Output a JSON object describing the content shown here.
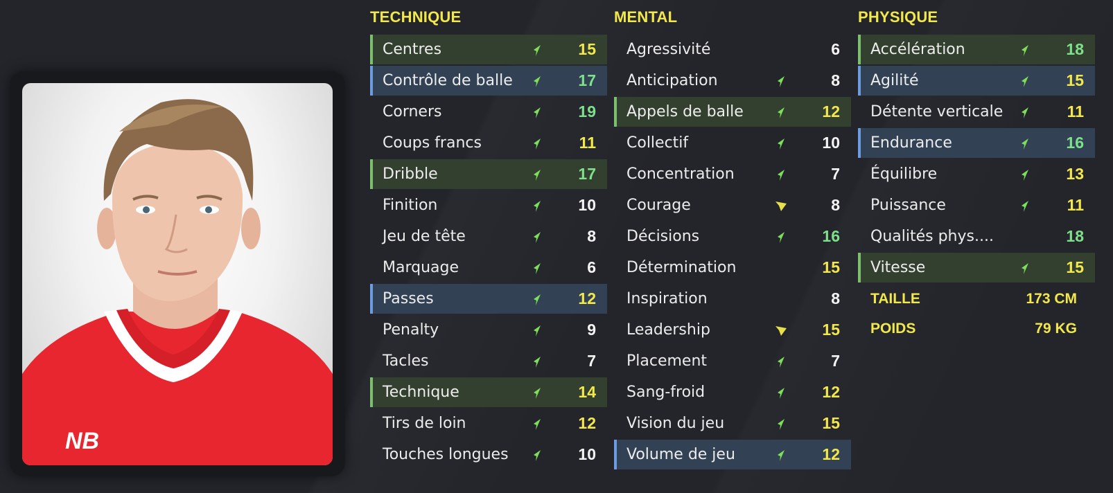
{
  "colors": {
    "header": "#f2e84c",
    "value_white": "#f4f4f4",
    "value_yellow": "#f2e84c",
    "value_green": "#7ee08a",
    "highlight_green": "#34402f",
    "highlight_blue": "#324254",
    "arrow_up": "#7ee05a",
    "arrow_neutral": "#e8e04a"
  },
  "technique": {
    "header": "TECHNIQUE",
    "rows": [
      {
        "label": "Centres",
        "value": "15",
        "tone": "yellow",
        "arrow": "up",
        "hl": "green"
      },
      {
        "label": "Contrôle de balle",
        "value": "17",
        "tone": "green",
        "arrow": "up",
        "hl": "blue"
      },
      {
        "label": "Corners",
        "value": "19",
        "tone": "green",
        "arrow": "up",
        "hl": ""
      },
      {
        "label": "Coups francs",
        "value": "11",
        "tone": "yellow",
        "arrow": "up",
        "hl": ""
      },
      {
        "label": "Dribble",
        "value": "17",
        "tone": "green",
        "arrow": "up",
        "hl": "green"
      },
      {
        "label": "Finition",
        "value": "10",
        "tone": "white",
        "arrow": "up",
        "hl": ""
      },
      {
        "label": "Jeu de tête",
        "value": "8",
        "tone": "white",
        "arrow": "up",
        "hl": ""
      },
      {
        "label": "Marquage",
        "value": "6",
        "tone": "white",
        "arrow": "up",
        "hl": ""
      },
      {
        "label": "Passes",
        "value": "12",
        "tone": "yellow",
        "arrow": "up",
        "hl": "blue"
      },
      {
        "label": "Penalty",
        "value": "9",
        "tone": "white",
        "arrow": "up",
        "hl": ""
      },
      {
        "label": "Tacles",
        "value": "7",
        "tone": "white",
        "arrow": "up",
        "hl": ""
      },
      {
        "label": "Technique",
        "value": "14",
        "tone": "yellow",
        "arrow": "up",
        "hl": "green"
      },
      {
        "label": "Tirs de loin",
        "value": "12",
        "tone": "yellow",
        "arrow": "up",
        "hl": ""
      },
      {
        "label": "Touches longues",
        "value": "10",
        "tone": "white",
        "arrow": "up",
        "hl": ""
      }
    ]
  },
  "mental": {
    "header": "MENTAL",
    "rows": [
      {
        "label": "Agressivité",
        "value": "6",
        "tone": "white",
        "arrow": "none",
        "hl": ""
      },
      {
        "label": "Anticipation",
        "value": "8",
        "tone": "white",
        "arrow": "up",
        "hl": ""
      },
      {
        "label": "Appels de balle",
        "value": "12",
        "tone": "yellow",
        "arrow": "up",
        "hl": "green"
      },
      {
        "label": "Collectif",
        "value": "10",
        "tone": "white",
        "arrow": "up",
        "hl": ""
      },
      {
        "label": "Concentration",
        "value": "7",
        "tone": "white",
        "arrow": "up",
        "hl": ""
      },
      {
        "label": "Courage",
        "value": "8",
        "tone": "white",
        "arrow": "neutral",
        "hl": ""
      },
      {
        "label": "Décisions",
        "value": "16",
        "tone": "green",
        "arrow": "up",
        "hl": ""
      },
      {
        "label": "Détermination",
        "value": "15",
        "tone": "yellow",
        "arrow": "none",
        "hl": ""
      },
      {
        "label": "Inspiration",
        "value": "8",
        "tone": "white",
        "arrow": "none",
        "hl": ""
      },
      {
        "label": "Leadership",
        "value": "15",
        "tone": "yellow",
        "arrow": "neutral",
        "hl": ""
      },
      {
        "label": "Placement",
        "value": "7",
        "tone": "white",
        "arrow": "up",
        "hl": ""
      },
      {
        "label": "Sang-froid",
        "value": "12",
        "tone": "yellow",
        "arrow": "up",
        "hl": ""
      },
      {
        "label": "Vision du jeu",
        "value": "15",
        "tone": "yellow",
        "arrow": "up",
        "hl": ""
      },
      {
        "label": "Volume de jeu",
        "value": "12",
        "tone": "yellow",
        "arrow": "up",
        "hl": "blue"
      }
    ]
  },
  "physique": {
    "header": "PHYSIQUE",
    "rows": [
      {
        "label": "Accélération",
        "value": "18",
        "tone": "green",
        "arrow": "up",
        "hl": "green"
      },
      {
        "label": "Agilité",
        "value": "15",
        "tone": "yellow",
        "arrow": "up",
        "hl": "blue"
      },
      {
        "label": "Détente verticale",
        "value": "11",
        "tone": "yellow",
        "arrow": "up",
        "hl": ""
      },
      {
        "label": "Endurance",
        "value": "16",
        "tone": "green",
        "arrow": "up",
        "hl": "blue"
      },
      {
        "label": "Équilibre",
        "value": "13",
        "tone": "yellow",
        "arrow": "up",
        "hl": ""
      },
      {
        "label": "Puissance",
        "value": "11",
        "tone": "yellow",
        "arrow": "up",
        "hl": ""
      },
      {
        "label": "Qualités phys....",
        "value": "18",
        "tone": "green",
        "arrow": "none",
        "hl": ""
      },
      {
        "label": "Vitesse",
        "value": "15",
        "tone": "yellow",
        "arrow": "up",
        "hl": "green"
      }
    ],
    "height_label": "TAILLE",
    "height_value": "173 CM",
    "weight_label": "POIDS",
    "weight_value": "79 KG"
  }
}
